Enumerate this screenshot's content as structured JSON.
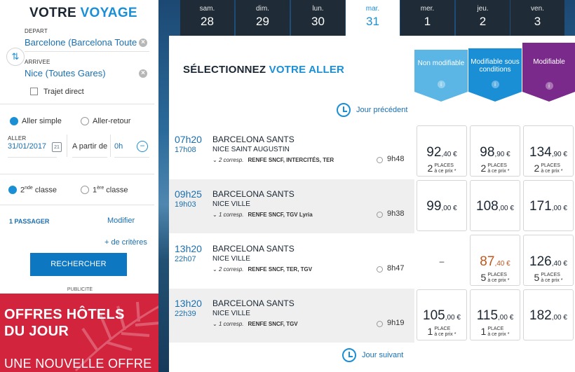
{
  "sidebar": {
    "title_main": "VOTRE ",
    "title_accent": "VOYAGE",
    "depart_label": "DEPART",
    "depart_value": "Barcelone (Barcelona Toutes Gares)",
    "arrivee_label": "ARRIVEE",
    "arrivee_value": "Nice (Toutes Gares)",
    "trajet_direct": "Trajet direct",
    "aller_simple": "Aller simple",
    "aller_retour": "Aller-retour",
    "aller_label": "ALLER",
    "aller_date": "31/01/2017",
    "cal_day": "21",
    "a_partir_de": "A partir de",
    "heure": "0h",
    "classe2_num": "2",
    "classe2_sup": "nde",
    "classe2_txt": " classe",
    "classe1_num": "1",
    "classe1_sup": "ère",
    "classe1_txt": " classe",
    "passagers": "1 PASSAGER",
    "modifier": "Modifier",
    "criteres": "+ de critères",
    "rechercher": "RECHERCHER"
  },
  "ad": {
    "tag": "PUBLICITÉ",
    "line1": "OFFRES HÔTELS",
    "line2": "DU JOUR",
    "line3": "UNE NOUVELLE OFFRE"
  },
  "days": [
    {
      "name": "sam.",
      "num": "28",
      "selected": false
    },
    {
      "name": "dim.",
      "num": "29",
      "selected": false
    },
    {
      "name": "lun.",
      "num": "30",
      "selected": false
    },
    {
      "name": "mar.",
      "num": "31",
      "selected": true
    },
    {
      "name": "mer.",
      "num": "1",
      "selected": false
    },
    {
      "name": "jeu.",
      "num": "2",
      "selected": false
    },
    {
      "name": "ven.",
      "num": "3",
      "selected": false
    }
  ],
  "main": {
    "title_main": "SÉLECTIONNEZ ",
    "title_accent": "VOTRE ALLER",
    "jour_precedent": "Jour précédent",
    "jour_suivant": "Jour suivant",
    "tariffs": [
      {
        "label": "Non modifiable",
        "info": "i",
        "color": "#5bb6e5"
      },
      {
        "label": "Modifiable sous conditions",
        "info": "i",
        "color": "#1a8fd6"
      },
      {
        "label": "Modifiable",
        "info": "i",
        "color": "#7a2a8a"
      }
    ]
  },
  "trains": [
    {
      "dep": "07h20",
      "arr": "17h08",
      "from": "BARCELONA SANTS",
      "to": "NICE SAINT AUGUSTIN",
      "corresp": "2 corresp.",
      "operators": "RENFE SNCF, INTERCITÉS, TER",
      "duration": "9h48",
      "prices": [
        {
          "int": "92",
          "dec": ",40 €",
          "places": "2",
          "pl1": "PLACES",
          "pl2": "à ce prix *"
        },
        {
          "int": "98",
          "dec": ",90 €",
          "places": "2",
          "pl1": "PLACES",
          "pl2": "à ce prix *"
        },
        {
          "int": "134",
          "dec": ",90 €",
          "places": "2",
          "pl1": "PLACES",
          "pl2": "à ce prix *"
        }
      ]
    },
    {
      "dep": "09h25",
      "arr": "19h03",
      "from": "BARCELONA SANTS",
      "to": "NICE VILLE",
      "corresp": "1 corresp.",
      "operators": "RENFE SNCF, TGV Lyria",
      "duration": "9h38",
      "prices": [
        {
          "int": "99",
          "dec": ",00 €"
        },
        {
          "int": "108",
          "dec": ",00 €"
        },
        {
          "int": "171",
          "dec": ",00 €"
        }
      ]
    },
    {
      "dep": "13h20",
      "arr": "22h07",
      "from": "BARCELONA SANTS",
      "to": "NICE VILLE",
      "corresp": "2 corresp.",
      "operators": "RENFE SNCF, TER, TGV",
      "duration": "8h47",
      "prices": [
        {
          "dash": "–"
        },
        {
          "int": "87",
          "dec": ",40 €",
          "places": "5",
          "pl1": "PLACES",
          "pl2": "à ce prix *",
          "orange": true
        },
        {
          "int": "126",
          "dec": ",40 €",
          "places": "5",
          "pl1": "PLACES",
          "pl2": "à ce prix *"
        }
      ]
    },
    {
      "dep": "13h20",
      "arr": "22h39",
      "from": "BARCELONA SANTS",
      "to": "NICE VILLE",
      "corresp": "1 corresp.",
      "operators": "RENFE SNCF, TGV",
      "duration": "9h19",
      "prices": [
        {
          "int": "105",
          "dec": ",00 €",
          "places": "1",
          "pl1": "PLACE",
          "pl2": "à ce prix *"
        },
        {
          "int": "115",
          "dec": ",00 €",
          "places": "1",
          "pl1": "PLACE",
          "pl2": "à ce prix *"
        },
        {
          "int": "182",
          "dec": ",00 €"
        }
      ]
    }
  ]
}
